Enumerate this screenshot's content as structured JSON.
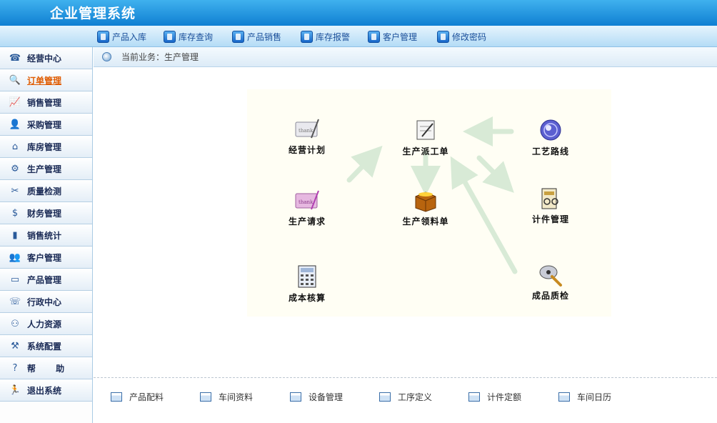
{
  "app": {
    "title": "企业管理系统"
  },
  "topnav": [
    {
      "label": "产品入库",
      "icon": "product-in-icon"
    },
    {
      "label": "库存查询",
      "icon": "stock-query-icon"
    },
    {
      "label": "产品销售",
      "icon": "product-sales-icon"
    },
    {
      "label": "库存报警",
      "icon": "stock-alarm-icon"
    },
    {
      "label": "客户管理",
      "icon": "customer-icon"
    },
    {
      "label": "修改密码",
      "icon": "key-icon"
    }
  ],
  "sidebar": [
    {
      "label": "经营中心",
      "icon": "business-center-icon"
    },
    {
      "label": "订单管理",
      "icon": "order-icon"
    },
    {
      "label": "销售管理",
      "icon": "sales-chart-icon"
    },
    {
      "label": "采购管理",
      "icon": "purchase-icon"
    },
    {
      "label": "库房管理",
      "icon": "warehouse-icon"
    },
    {
      "label": "生产管理",
      "icon": "production-icon"
    },
    {
      "label": "质量检测",
      "icon": "quality-icon"
    },
    {
      "label": "财务管理",
      "icon": "finance-icon"
    },
    {
      "label": "销售统计",
      "icon": "bar-chart-icon"
    },
    {
      "label": "客户管理",
      "icon": "customers-icon"
    },
    {
      "label": "产品管理",
      "icon": "product-icon"
    },
    {
      "label": "行政中心",
      "icon": "phone-icon"
    },
    {
      "label": "人力资源",
      "icon": "people-icon"
    },
    {
      "label": "系统配置",
      "icon": "tools-icon"
    },
    {
      "label": "帮 助",
      "icon": "help-icon"
    },
    {
      "label": "退出系统",
      "icon": "exit-icon"
    }
  ],
  "breadcrumb": {
    "text": "当前业务：生产管理"
  },
  "flow": {
    "plan": "经营计划",
    "dispatch": "生产派工单",
    "route": "工艺路线",
    "request": "生产请求",
    "material": "生产领料单",
    "piecework": "计件管理",
    "cost": "成本核算",
    "inspection": "成品质检"
  },
  "bottombar": [
    "产品配料",
    "车间资料",
    "设备管理",
    "工序定义",
    "计件定额",
    "车间日历"
  ],
  "colors": {
    "title_bar": "#0f7fd2",
    "active_sidebar": "#e05b00",
    "arrow": "#d8ead6"
  }
}
